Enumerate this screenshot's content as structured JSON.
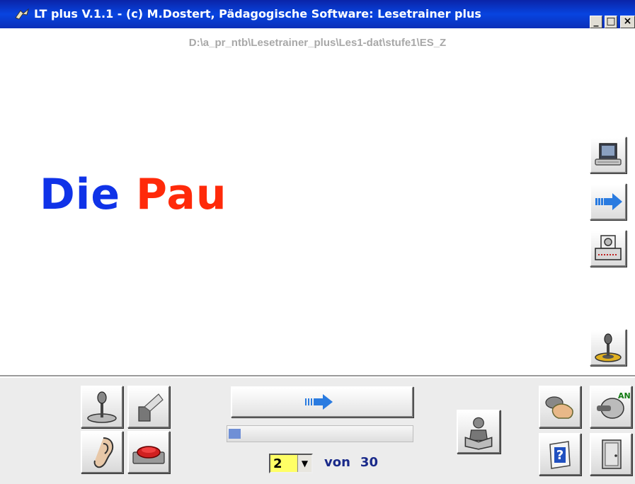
{
  "window": {
    "title": "LT plus   V.1.1 - (c) M.Dostert, Pädagogische Software: Lesetrainer plus",
    "minimize_label": "_",
    "maximize_label": "□",
    "close_label": "×"
  },
  "path": "D:\\a_pr_ntb\\Lesetrainer_plus\\Les1-dat\\stufe1\\ES_Z",
  "display": {
    "word1": "Die",
    "word2": "Pau",
    "word1_color": "#1033e8",
    "word2_color": "#ff2a0a"
  },
  "right_toolbar": [
    {
      "name": "computer-icon"
    },
    {
      "name": "arrow-right-icon"
    },
    {
      "name": "printer-icon"
    },
    {
      "name": "microphone-icon"
    }
  ],
  "bottom_left_tools": [
    {
      "name": "microphone-icon"
    },
    {
      "name": "eraser-icon"
    },
    {
      "name": "ear-icon"
    },
    {
      "name": "stop-button-icon"
    }
  ],
  "bottom": {
    "progress": 0.067,
    "page_current": "2",
    "page_of_label": "von",
    "page_total": "30"
  },
  "bottom_right_tools": [
    {
      "name": "reading-person-icon"
    },
    {
      "name": "hand-mouse-icon"
    },
    {
      "name": "switch-on-icon",
      "label": "AN"
    },
    {
      "name": "help-icon",
      "label": "?"
    },
    {
      "name": "exit-door-icon"
    }
  ],
  "colors": {
    "titlebar": "#0844e0",
    "accent_blue": "#2a7be0",
    "page_select_bg": "#ffff66"
  }
}
